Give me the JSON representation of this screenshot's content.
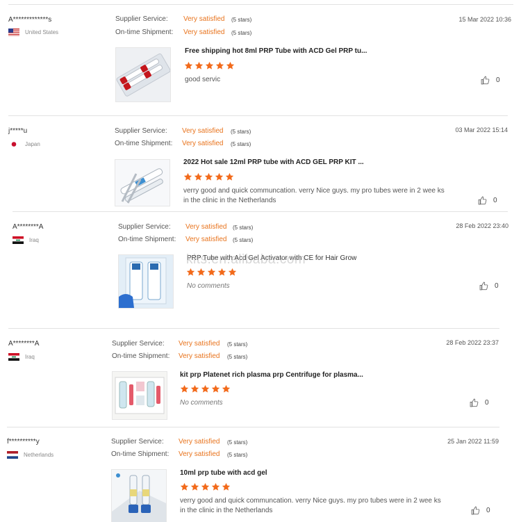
{
  "labels": {
    "supplier_service": "Supplier Service:",
    "ontime_shipment": "On-time Shipment:",
    "no_comments": "No comments"
  },
  "colors": {
    "accent": "#e8731c",
    "star": "#f26a1b"
  },
  "watermark": "kits.en.alibaba.com",
  "reviews": [
    {
      "user": "A*************s",
      "country": "United States",
      "flag": "flag-us-icon",
      "supplier_service": "Very satisfied",
      "supplier_stars": "(5 stars)",
      "shipment": "Very satisfied",
      "shipment_stars": "(5 stars)",
      "date": "15 Mar 2022 10:36",
      "product": "Free shipping hot 8ml PRP Tube with ACD Gel PRP tu...",
      "rating": 5,
      "comment": "good servic",
      "likes": "0"
    },
    {
      "user": "j*****u",
      "country": "Japan",
      "flag": "flag-jp-icon",
      "supplier_service": "Very satisfied",
      "supplier_stars": "(5 stars)",
      "shipment": "Very satisfied",
      "shipment_stars": "(5 stars)",
      "date": "03 Mar 2022 15:14",
      "product": "2022 Hot sale 12ml PRP tube with ACD GEL PRP KIT ...",
      "rating": 5,
      "comment": "verry good and quick communcation. verry Nice guys. my pro tubes were in 2 wee ks in the clinic in the Netherlands",
      "likes": "0"
    },
    {
      "user": "A********A",
      "country": "Iraq",
      "flag": "flag-iq-icon",
      "supplier_service": "Very satisfied",
      "supplier_stars": "(5 stars)",
      "shipment": "Very satisfied",
      "shipment_stars": "(5 stars)",
      "date": "28 Feb 2022 23:40",
      "product": "PRP Tube with Acd Gel Activator with CE for Hair Grow",
      "rating": 5,
      "comment": "No comments",
      "likes": "0"
    },
    {
      "user": "A********A",
      "country": "Iraq",
      "flag": "flag-iq-icon",
      "supplier_service": "Very satisfied",
      "supplier_stars": "(5 stars)",
      "shipment": "Very satisfied",
      "shipment_stars": "(5 stars)",
      "date": "28 Feb 2022 23:37",
      "product": "kit prp Platenet rich plasma prp Centrifuge for plasma...",
      "rating": 5,
      "comment": "No comments",
      "likes": "0"
    },
    {
      "user": "f**********y",
      "country": "Netherlands",
      "flag": "flag-nl-icon",
      "supplier_service": "Very satisfied",
      "supplier_stars": "(5 stars)",
      "shipment": "Very satisfied",
      "shipment_stars": "(5 stars)",
      "date": "25 Jan 2022 11:59",
      "product": "10ml prp tube with acd gel",
      "rating": 5,
      "comment": "verry good and quick communcation. verry Nice guys. my pro tubes were in 2 wee ks in the clinic in the Netherlands",
      "likes": "0"
    }
  ]
}
